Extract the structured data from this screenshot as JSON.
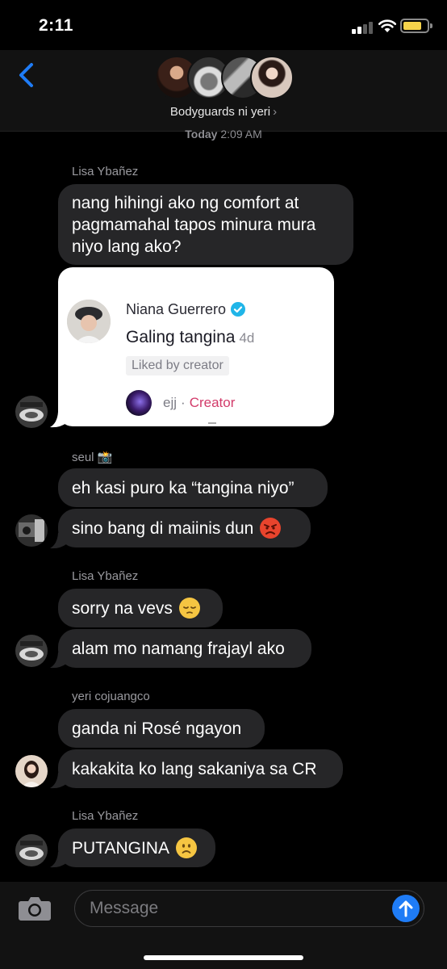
{
  "status_bar": {
    "time": "2:11"
  },
  "header": {
    "group_name": "Bodyguards ni yeri",
    "chevron": "›"
  },
  "timestamp": {
    "day": "Today",
    "time": "2:09 AM"
  },
  "messages": [
    {
      "sender": "Lisa Ybañez",
      "text": "nang hihingi ako ng comfort at pagmamahal tapos minura mura niyo lang ako?"
    },
    {
      "sender": "seul 📸",
      "text": "eh kasi puro ka “tangina niyo”"
    },
    {
      "text": "sino bang di maiinis dun",
      "emoji": "angry-face"
    },
    {
      "sender": "Lisa Ybañez",
      "text": "sorry na vevs",
      "emoji": "pensive-face"
    },
    {
      "text": "alam mo namang frajayl ako"
    },
    {
      "sender": "yeri cojuangco",
      "text": "ganda ni Rosé ngayon"
    },
    {
      "text": "kakakita ko lang sakaniya sa CR"
    },
    {
      "sender": "Lisa Ybañez",
      "text": "PUTANGINA",
      "emoji": "slightly-frowning-face"
    }
  ],
  "shared_card": {
    "commenter": "Niana Guerrero",
    "comment": "Galing tangina",
    "age": "4d",
    "badge": "Liked by creator",
    "reply_user": "ejj",
    "reply_separator": "·",
    "reply_role": "Creator"
  },
  "composer": {
    "placeholder": "Message"
  },
  "colors": {
    "accent": "#1f7cf6",
    "bubble": "#262628",
    "creator": "#d23b6a"
  }
}
